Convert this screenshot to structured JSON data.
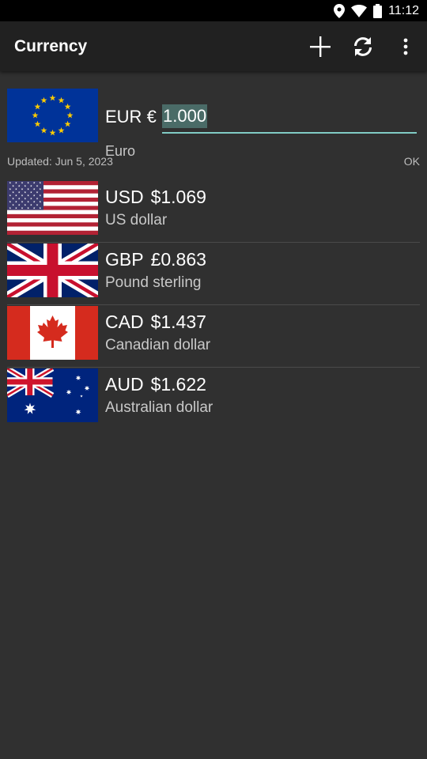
{
  "status_bar": {
    "time": "11:12",
    "icons": [
      "location-icon",
      "wifi-icon",
      "battery-icon"
    ]
  },
  "app_bar": {
    "title": "Currency",
    "actions": [
      "add-icon",
      "refresh-icon",
      "more-vert-icon"
    ]
  },
  "base": {
    "code": "EUR",
    "symbol": "€",
    "value": "1.000",
    "name": "Euro",
    "flag": "eu-flag-icon"
  },
  "updated": {
    "text": "Updated: Jun 5, 2023",
    "status": "OK"
  },
  "rates": [
    {
      "code": "USD",
      "value": "$1.069",
      "name": "US dollar",
      "flag": "us-flag-icon"
    },
    {
      "code": "GBP",
      "value": "£0.863",
      "name": "Pound sterling",
      "flag": "uk-flag-icon"
    },
    {
      "code": "CAD",
      "value": "$1.437",
      "name": "Canadian dollar",
      "flag": "canada-flag-icon"
    },
    {
      "code": "AUD",
      "value": "$1.622",
      "name": "Australian dollar",
      "flag": "australia-flag-icon"
    }
  ],
  "colors": {
    "background": "#303030",
    "app_bar": "#212121",
    "accent": "#80cbc4"
  }
}
